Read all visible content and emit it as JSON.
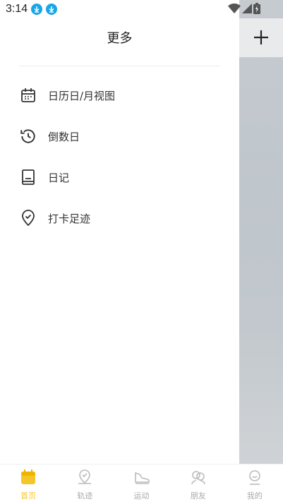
{
  "status": {
    "time": "3:14"
  },
  "drawer": {
    "title": "更多",
    "items": [
      {
        "label": "日历日/月视图",
        "icon": "calendar-icon"
      },
      {
        "label": "倒数日",
        "icon": "history-icon"
      },
      {
        "label": "日记",
        "icon": "diary-icon"
      },
      {
        "label": "打卡足迹",
        "icon": "location-check-icon"
      }
    ]
  },
  "nav": [
    {
      "label": "首页",
      "icon": "home-icon",
      "active": true
    },
    {
      "label": "轨迹",
      "icon": "map-pin-icon",
      "active": false
    },
    {
      "label": "运动",
      "icon": "shoe-icon",
      "active": false
    },
    {
      "label": "朋友",
      "icon": "friends-icon",
      "active": false
    },
    {
      "label": "我的",
      "icon": "profile-icon",
      "active": false
    }
  ],
  "colors": {
    "accent": "#f5c62a",
    "status_icon": "#19a6e6"
  }
}
